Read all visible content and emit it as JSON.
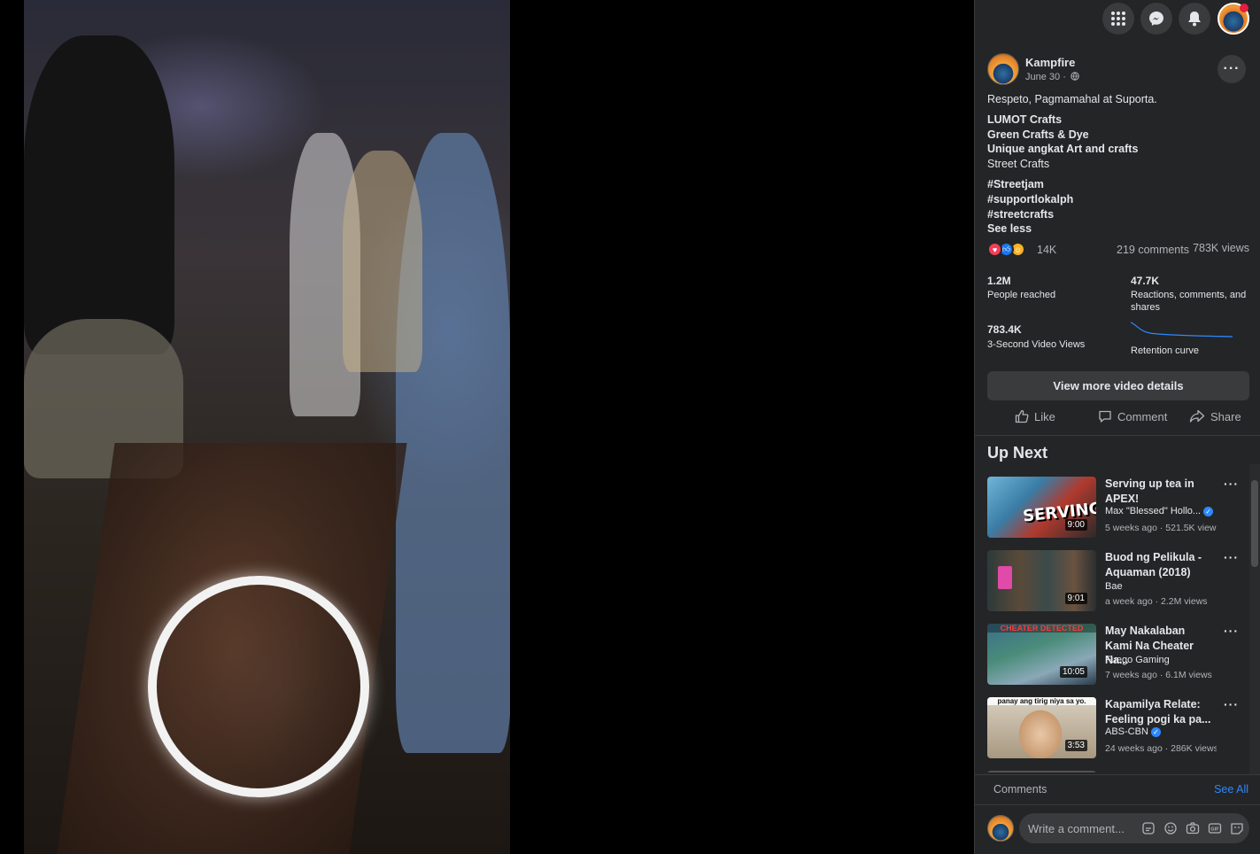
{
  "post": {
    "page_name": "Kampfire",
    "date": "June 30 ·",
    "text_lines": [
      "Respeto, Pagmamahal at Suporta.",
      "LUMOT Crafts",
      "Green Crafts & Dye",
      "Unique angkat Art and crafts",
      "Street Crafts",
      "#Streetjam",
      "#supportlokalph",
      "#streetcrafts",
      "See less"
    ],
    "reaction_count": "14K",
    "comments_count": "219 comments",
    "views_count": "783K views"
  },
  "stats": {
    "reached_value": "1.2M",
    "reached_label": "People reached",
    "engagement_value": "47.7K",
    "engagement_label": "Reactions, comments, and shares",
    "video_views_value": "783.4K",
    "video_views_label": "3-Second Video Views",
    "retention_label": "Retention curve"
  },
  "buttons": {
    "view_details": "View more video details",
    "like": "Like",
    "comment": "Comment",
    "share": "Share"
  },
  "up_next": {
    "title": "Up Next",
    "videos": [
      {
        "title": "Serving up tea in APEX!",
        "channel": "Max \"Blessed\" Hollo...",
        "meta": "5 weeks ago · 521.5K views",
        "duration": "9:00",
        "thumb_text": "SERVING",
        "verified": true
      },
      {
        "title": "Buod ng Pelikula - Aquaman (2018)",
        "channel": "Bae",
        "meta": "a week ago · 2.2M views",
        "duration": "9:01",
        "verified": false
      },
      {
        "title": "May Nakalaban Kami Na Cheater Na...",
        "channel": "Fuego Gaming",
        "meta": "7 weeks ago · 6.1M views",
        "duration": "10:05",
        "thumb_text": "CHEATER DETECTED",
        "verified": false
      },
      {
        "title": "Kapamilya Relate: Feeling pogi ka pa...",
        "channel": "ABS-CBN",
        "meta": "24 weeks ago · 286K views",
        "duration": "3:53",
        "thumb_text": "panay ang tirig niya sa yo.",
        "verified": true
      }
    ]
  },
  "comments": {
    "label": "Comments",
    "see_all": "See All",
    "placeholder": "Write a comment..."
  },
  "icons": [
    "menu-grid-icon",
    "messenger-icon",
    "bell-icon",
    "globe-icon",
    "more-icon",
    "like-icon",
    "comment-icon",
    "share-icon",
    "verified-icon",
    "sticker-icon",
    "emoji-icon",
    "camera-icon",
    "gif-icon"
  ],
  "colors": {
    "panel_bg": "#242526",
    "accent": "#2d88ff",
    "text": "#e4e6eb",
    "muted": "#b0b3b8",
    "like_blue": "#1877f2",
    "love_red": "#f33e58"
  }
}
